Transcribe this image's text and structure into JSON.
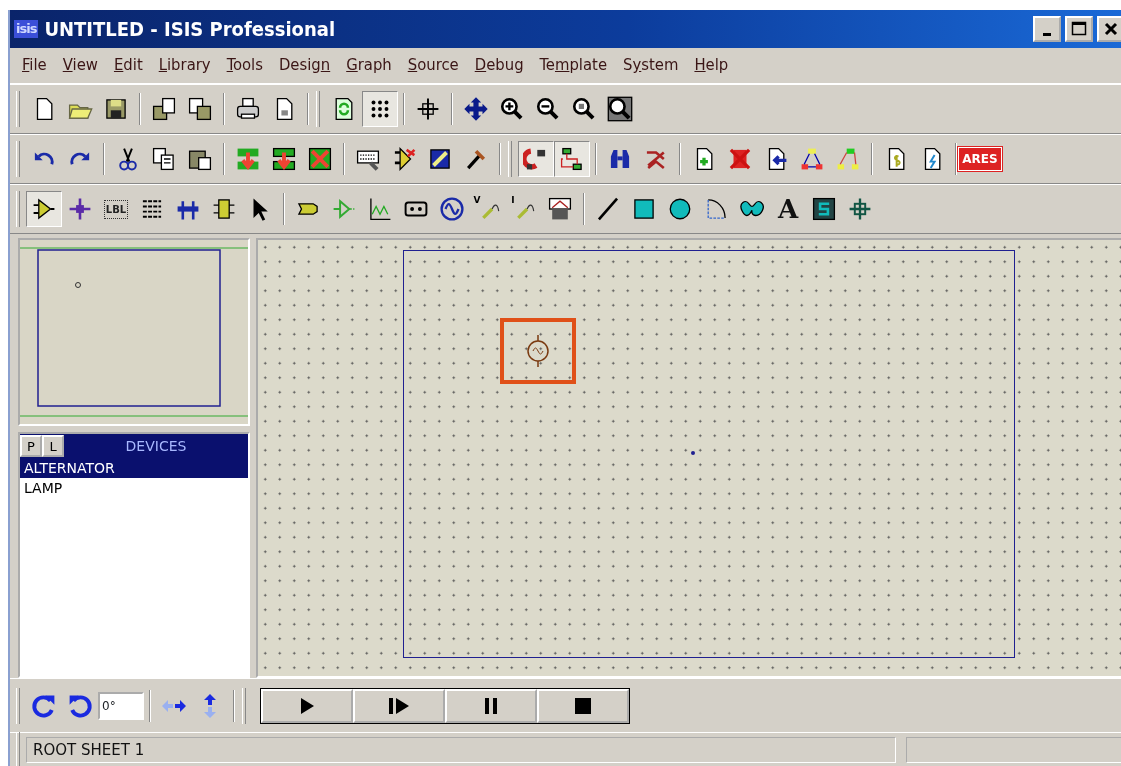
{
  "window": {
    "logo": "isis",
    "title": "UNTITLED - ISIS Professional"
  },
  "menu": [
    {
      "parts": [
        {
          "text": "F",
          "underlined": true
        },
        {
          "text": "ile",
          "underlined": false
        }
      ]
    },
    {
      "parts": [
        {
          "text": "V",
          "underlined": true
        },
        {
          "text": "iew",
          "underlined": false
        }
      ]
    },
    {
      "parts": [
        {
          "text": "E",
          "underlined": true
        },
        {
          "text": "dit",
          "underlined": false
        }
      ]
    },
    {
      "parts": [
        {
          "text": "L",
          "underlined": true
        },
        {
          "text": "ibrary",
          "underlined": false
        }
      ]
    },
    {
      "parts": [
        {
          "text": "T",
          "underlined": true
        },
        {
          "text": "ools",
          "underlined": false
        }
      ]
    },
    {
      "parts": [
        {
          "text": "Desig",
          "underlined": false
        },
        {
          "text": "n",
          "underlined": true
        }
      ]
    },
    {
      "parts": [
        {
          "text": "G",
          "underlined": true
        },
        {
          "text": "raph",
          "underlined": false
        }
      ]
    },
    {
      "parts": [
        {
          "text": "S",
          "underlined": true
        },
        {
          "text": "ource",
          "underlined": false
        }
      ]
    },
    {
      "parts": [
        {
          "text": "D",
          "underlined": true
        },
        {
          "text": "ebug",
          "underlined": false
        }
      ]
    },
    {
      "parts": [
        {
          "text": "Te",
          "underlined": false
        },
        {
          "text": "m",
          "underlined": true
        },
        {
          "text": "plate",
          "underlined": false
        }
      ]
    },
    {
      "parts": [
        {
          "text": "S",
          "underlined": false
        },
        {
          "text": "y",
          "underlined": true
        },
        {
          "text": "stem",
          "underlined": false
        }
      ]
    },
    {
      "parts": [
        {
          "text": "H",
          "underlined": true
        },
        {
          "text": "elp",
          "underlined": false
        }
      ]
    }
  ],
  "toolbars": [
    [
      [
        [
          {
            "kind": "new",
            "selected": false
          },
          {
            "kind": "open",
            "selected": false
          },
          {
            "kind": "save",
            "selected": false
          }
        ],
        [
          {
            "kind": "import",
            "selected": false
          },
          {
            "kind": "export",
            "selected": false
          }
        ],
        [
          {
            "kind": "print",
            "selected": false
          },
          {
            "kind": "area",
            "selected": false
          }
        ]
      ],
      [
        [
          {
            "kind": "refresh",
            "selected": false
          },
          {
            "kind": "grid",
            "selected": true
          }
        ],
        [
          {
            "kind": "origin",
            "selected": false
          }
        ],
        [
          {
            "kind": "pan",
            "selected": false
          },
          {
            "kind": "zoomin",
            "selected": false
          },
          {
            "kind": "zoomout",
            "selected": false
          },
          {
            "kind": "zoomall",
            "selected": false
          },
          {
            "kind": "zoomarea",
            "selected": false
          }
        ]
      ]
    ],
    [
      [
        [
          {
            "kind": "undo",
            "selected": false
          },
          {
            "kind": "redo",
            "selected": false
          }
        ],
        [
          {
            "kind": "cut",
            "selected": false
          },
          {
            "kind": "copy",
            "selected": false
          },
          {
            "kind": "paste",
            "selected": false
          }
        ],
        [
          {
            "kind": "blockcopy",
            "selected": false
          },
          {
            "kind": "blockmove",
            "selected": false
          },
          {
            "kind": "blockdelete",
            "selected": false
          }
        ],
        [
          {
            "kind": "keyboard",
            "selected": false
          },
          {
            "kind": "pick",
            "selected": false
          },
          {
            "kind": "decompose",
            "selected": false
          },
          {
            "kind": "hammer",
            "selected": false
          }
        ]
      ],
      [
        [
          {
            "kind": "magnet",
            "selected": true
          },
          {
            "kind": "router",
            "selected": true
          }
        ],
        [
          {
            "kind": "binoculars",
            "selected": false
          },
          {
            "kind": "property",
            "selected": false
          }
        ],
        [
          {
            "kind": "newsheet",
            "selected": false
          },
          {
            "kind": "delsheet",
            "selected": false
          },
          {
            "kind": "exitsheet",
            "selected": false
          },
          {
            "kind": "netlist",
            "selected": false
          },
          {
            "kind": "netlist2",
            "selected": false
          }
        ],
        [
          {
            "kind": "bom",
            "selected": false
          },
          {
            "kind": "spice",
            "selected": false
          }
        ],
        [
          {
            "kind": "ares",
            "label": "ARES",
            "selected": false
          }
        ]
      ]
    ],
    [
      [
        [
          {
            "kind": "component",
            "selected": true
          },
          {
            "kind": "junction",
            "selected": false
          },
          {
            "kind": "lbl",
            "label": "LBL",
            "selected": false
          },
          {
            "kind": "script",
            "selected": false
          },
          {
            "kind": "bus",
            "selected": false
          },
          {
            "kind": "subcircuit",
            "selected": false
          },
          {
            "kind": "select",
            "selected": false
          }
        ],
        [
          {
            "kind": "terminal",
            "selected": false
          },
          {
            "kind": "pin",
            "selected": false
          },
          {
            "kind": "graph",
            "selected": false
          },
          {
            "kind": "tape",
            "selected": false
          },
          {
            "kind": "generator",
            "selected": false
          },
          {
            "kind": "vprobe",
            "label": "V",
            "selected": false
          },
          {
            "kind": "iprobe",
            "label": "I",
            "selected": false
          },
          {
            "kind": "instrument",
            "selected": false
          }
        ],
        [
          {
            "kind": "line",
            "selected": false
          },
          {
            "kind": "box",
            "selected": false
          },
          {
            "kind": "circle",
            "selected": false
          },
          {
            "kind": "arc",
            "selected": false
          },
          {
            "kind": "path",
            "selected": false
          },
          {
            "kind": "text",
            "label": "A",
            "selected": false
          },
          {
            "kind": "symbol",
            "selected": false
          },
          {
            "kind": "marker",
            "selected": false
          }
        ]
      ]
    ]
  ],
  "devices": {
    "tabs": [
      {
        "label": "P"
      },
      {
        "label": "L"
      }
    ],
    "title": "DEVICES",
    "items": [
      {
        "label": "ALTERNATOR",
        "selected": true
      },
      {
        "label": "LAMP",
        "selected": false
      }
    ]
  },
  "canvas": {
    "components": [
      {
        "kind": "alternator",
        "selected": true
      }
    ]
  },
  "bottom": {
    "rotation": {
      "value": "0°"
    },
    "sim": [
      {
        "kind": "play"
      },
      {
        "kind": "step"
      },
      {
        "kind": "pause"
      },
      {
        "kind": "stop"
      }
    ]
  },
  "status_bar": {
    "text": "ROOT SHEET 1"
  }
}
